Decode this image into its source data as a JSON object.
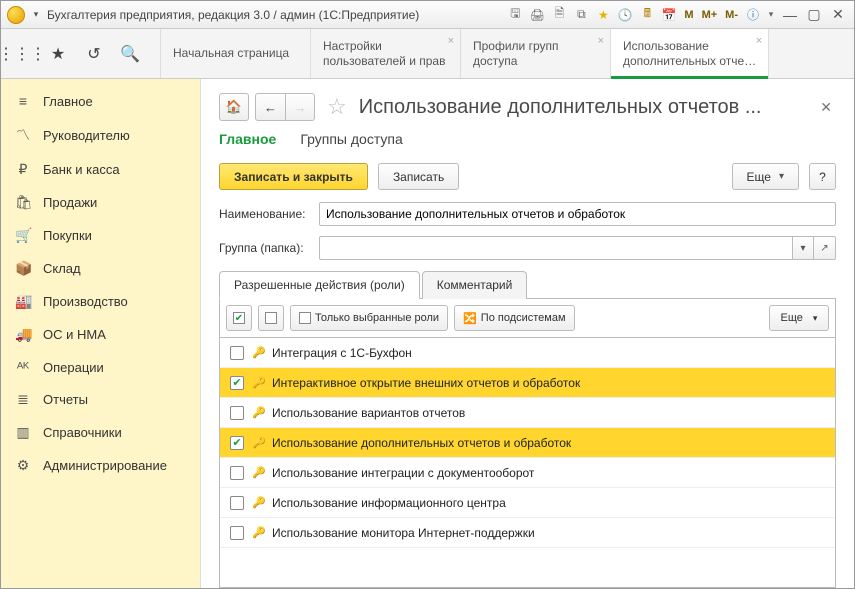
{
  "titlebar": {
    "text": "Бухгалтерия предприятия, редакция 3.0 / админ  (1С:Предприятие)",
    "mbuttons": [
      "M",
      "M+",
      "M-"
    ]
  },
  "tabs": [
    {
      "line1": "Начальная страница",
      "line2": "",
      "closable": false
    },
    {
      "line1": "Настройки",
      "line2": "пользователей и прав",
      "closable": true
    },
    {
      "line1": "Профили групп",
      "line2": "доступа",
      "closable": true
    },
    {
      "line1": "Использование",
      "line2": "дополнительных отче…",
      "closable": true,
      "active": true
    }
  ],
  "sidebar": {
    "items": [
      {
        "icon": "≡",
        "label": "Главное"
      },
      {
        "icon": "〽",
        "label": "Руководителю"
      },
      {
        "icon": "₽",
        "label": "Банк и касса"
      },
      {
        "icon": "🛍",
        "label": "Продажи"
      },
      {
        "icon": "🛒",
        "label": "Покупки"
      },
      {
        "icon": "📦",
        "label": "Склад"
      },
      {
        "icon": "🏭",
        "label": "Производство"
      },
      {
        "icon": "🚚",
        "label": "ОС и НМА"
      },
      {
        "icon": "ᴬᴷ",
        "label": "Операции"
      },
      {
        "icon": "≣",
        "label": "Отчеты"
      },
      {
        "icon": "▥",
        "label": "Справочники"
      },
      {
        "icon": "⚙",
        "label": "Администрирование"
      }
    ]
  },
  "page": {
    "title": "Использование дополнительных отчетов ...",
    "subtabs": {
      "main": "Главное",
      "groups": "Группы доступа"
    },
    "buttons": {
      "save_close": "Записать и закрыть",
      "save": "Записать",
      "more": "Еще",
      "help": "?"
    },
    "fields": {
      "name_label": "Наименование:",
      "name_value": "Использование дополнительных отчетов и обработок",
      "group_label": "Группа (папка):",
      "group_value": ""
    },
    "inner_tabs": {
      "roles": "Разрешенные действия (роли)",
      "comment": "Комментарий"
    },
    "roles_toolbar": {
      "only_selected": "Только выбранные роли",
      "by_subsystems": "По подсистемам",
      "more": "Еще"
    },
    "roles": [
      {
        "checked": false,
        "label": "Интеграция с 1С-Бухфон"
      },
      {
        "checked": true,
        "label": "Интерактивное открытие внешних отчетов и обработок",
        "selected": true
      },
      {
        "checked": false,
        "label": "Использование вариантов отчетов"
      },
      {
        "checked": true,
        "label": "Использование дополнительных отчетов и обработок",
        "selected": true
      },
      {
        "checked": false,
        "label": "Использование интеграции с документооборот"
      },
      {
        "checked": false,
        "label": "Использование информационного центра"
      },
      {
        "checked": false,
        "label": "Использование монитора Интернет-поддержки"
      }
    ]
  }
}
